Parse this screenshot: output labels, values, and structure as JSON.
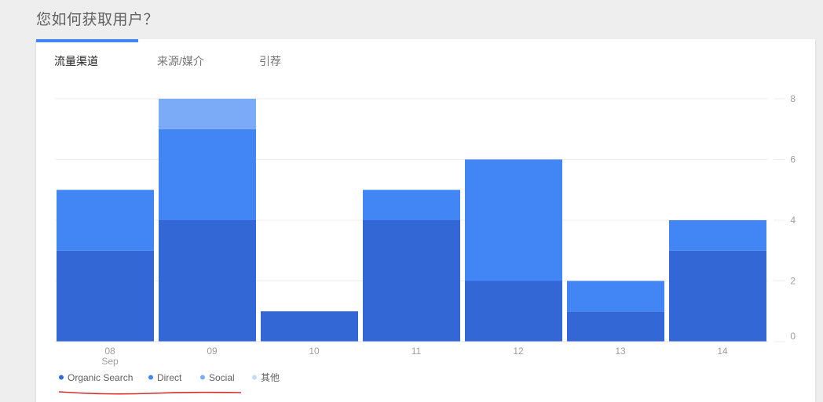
{
  "page": {
    "title": "您如何获取用户？"
  },
  "tabs": [
    {
      "label": "流量渠道",
      "active": true
    },
    {
      "label": "来源/媒介",
      "active": false
    },
    {
      "label": "引荐",
      "active": false
    }
  ],
  "colors": {
    "accent": "#4285f4",
    "annotation": "#d32f2f"
  },
  "chart_data": {
    "type": "bar",
    "stacked": true,
    "categories": [
      "08",
      "09",
      "10",
      "11",
      "12",
      "13",
      "14"
    ],
    "category_sublabels": [
      "Sep",
      "",
      "",
      "",
      "",
      "",
      ""
    ],
    "series": [
      {
        "name": "Organic Search",
        "color": "#3367d6",
        "values": [
          3,
          4,
          1,
          4,
          2,
          1,
          3
        ]
      },
      {
        "name": "Direct",
        "color": "#4285f4",
        "values": [
          2,
          3,
          0,
          1,
          4,
          1,
          1
        ]
      },
      {
        "name": "Social",
        "color": "#7baaf7",
        "values": [
          0,
          1,
          0,
          0,
          0,
          0,
          0
        ]
      },
      {
        "name": "其他",
        "color": "#c6dafc",
        "values": [
          0,
          0,
          0,
          0,
          0,
          0,
          0
        ]
      }
    ],
    "y_ticks": [
      0,
      2,
      4,
      6,
      8
    ],
    "ylim": [
      0,
      8
    ],
    "y_axis_side": "right",
    "grid": true,
    "legend_position": "bottom-left"
  }
}
